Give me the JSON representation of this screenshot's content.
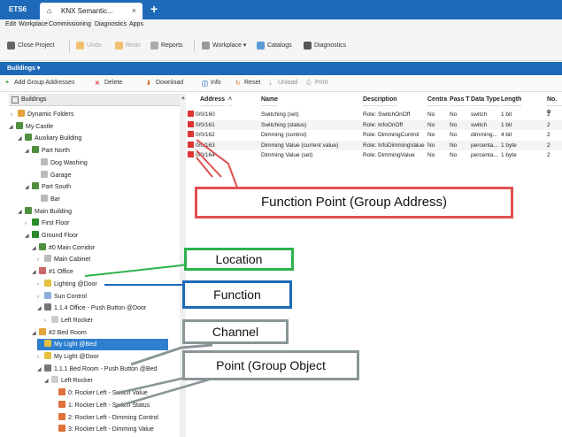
{
  "titlebar": {
    "app": "ETS6",
    "tab_label": "KNX Semantic...",
    "close": "×",
    "new_tab": "+"
  },
  "menu": [
    "Edit",
    "Workplace",
    "Commissioning",
    "Diagnostics",
    "Apps"
  ],
  "toolbar": {
    "close_project": "Close Project",
    "undo": "Undo",
    "redo": "Redo",
    "reports": "Reports",
    "workplace": "Workplace ▾",
    "catalogs": "Catalogs",
    "diagnostics": "Diagnostics"
  },
  "panel_header": "Buildings ▾",
  "toolbar2": {
    "add": "Add Group Addresses",
    "delete": "Delete",
    "download": "Download",
    "info": "Info",
    "reset": "Reset",
    "unload": "Unload",
    "print": "Print"
  },
  "tree": {
    "header": "Buildings",
    "items": [
      "Dynamic Folders",
      "My Castle",
      "Auxiliary Building",
      "Part North",
      "Dog Washing",
      "Garage",
      "Part South",
      "Bar",
      "Main Building",
      "First Floor",
      "Ground Floor",
      "#0 Main Corridor",
      "Main Cabinet",
      "#1 Office",
      "Lighting @Door",
      "Sun Control",
      "1.1.4 Office - Push Button @Door",
      "Left Rocker",
      "#2 Bed Room",
      "My Light @Bed",
      "My Light @Door",
      "1.1.1 Bed Room - Push Button @Bed",
      "Left Rocker",
      "0: Rocker Left - Switch Value",
      "1: Rocker Left - Switch Status",
      "2: Rocker Left - Dimming Control",
      "3: Rocker Left - Dimming Value"
    ]
  },
  "table": {
    "headers": [
      "Address",
      "Name",
      "Description",
      "Centra",
      "Pass T",
      "Data Type",
      "Length",
      "No. o"
    ],
    "rows": [
      [
        "0/0/160",
        "Switching (set)",
        "Role: SwitchOnOff",
        "No",
        "No",
        "switch",
        "1 bit",
        "2"
      ],
      [
        "0/0/161",
        "Switching (status)",
        "Role: InfoOnOff",
        "No",
        "No",
        "switch",
        "1 bit",
        "2"
      ],
      [
        "0/0/162",
        "Dimming (control)",
        "Role: DimmingControl",
        "No",
        "No",
        "dimming...",
        "4 bit",
        "2"
      ],
      [
        "0/0/163",
        "Dimming Value (current value)",
        "Role: InfoDimmingValue",
        "No",
        "No",
        "percenta...",
        "1 byte",
        "2"
      ],
      [
        "0/0/164",
        "Dimming Value (set)",
        "Role: DimmingValue",
        "No",
        "No",
        "percenta...",
        "1 byte",
        "2"
      ]
    ]
  },
  "callouts": {
    "function_point": "Function Point (Group Address)",
    "location": "Location",
    "function": "Function",
    "channel": "Channel",
    "point": "Point (Group Object"
  },
  "colors": {
    "brand": "#1e6ab8",
    "red": "#e05050",
    "green": "#2bb24c",
    "blue": "#1e6ab8",
    "gray": "#8a9597"
  }
}
